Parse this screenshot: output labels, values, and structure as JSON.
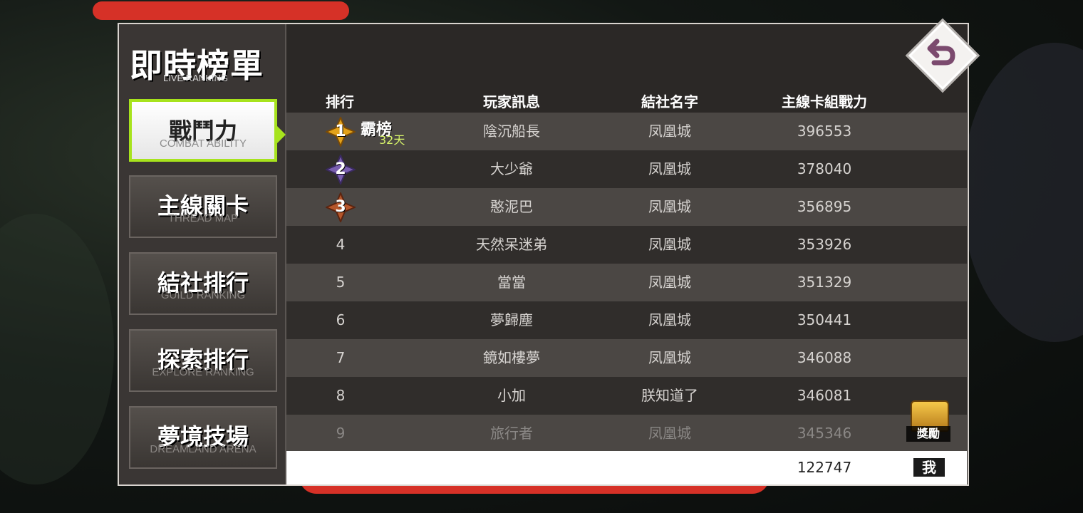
{
  "page": {
    "title_zh": "即時榜單",
    "title_en": "LIVE RANKING"
  },
  "tabs": [
    {
      "zh": "戰鬥力",
      "en": "COMBAT ABILITY",
      "active": true
    },
    {
      "zh": "主線關卡",
      "en": "THREAD MAP",
      "active": false
    },
    {
      "zh": "結社排行",
      "en": "GUILD RANKING",
      "active": false
    },
    {
      "zh": "探索排行",
      "en": "EXPLORE RANKING",
      "active": false
    },
    {
      "zh": "夢境技場",
      "en": "DREAMLAND ARENA",
      "active": false
    }
  ],
  "table": {
    "headers": {
      "rank": "排行",
      "player": "玩家訊息",
      "guild": "結社名字",
      "power": "主線卡組戰力"
    },
    "champion": {
      "label": "霸榜",
      "days": "32天"
    },
    "rows": [
      {
        "rank": "1",
        "player": "陰沉船長",
        "guild": "凤凰城",
        "power": "396553"
      },
      {
        "rank": "2",
        "player": "大少爺",
        "guild": "凤凰城",
        "power": "378040"
      },
      {
        "rank": "3",
        "player": "憨泥巴",
        "guild": "凤凰城",
        "power": "356895"
      },
      {
        "rank": "4",
        "player": "天然呆迷弟",
        "guild": "凤凰城",
        "power": "353926"
      },
      {
        "rank": "5",
        "player": "當當",
        "guild": "凤凰城",
        "power": "351329"
      },
      {
        "rank": "6",
        "player": "夢歸塵",
        "guild": "凤凰城",
        "power": "350441"
      },
      {
        "rank": "7",
        "player": "鏡如樓夢",
        "guild": "凤凰城",
        "power": "346088"
      },
      {
        "rank": "8",
        "player": "小加",
        "guild": "朕知道了",
        "power": "346081"
      },
      {
        "rank": "9",
        "player": "旅行者",
        "guild": "凤凰城",
        "power": "345346"
      }
    ]
  },
  "self_row": {
    "power": "122747",
    "me_label": "我"
  },
  "reward": {
    "label": "獎勵"
  },
  "icons": {
    "back": "back-arrow-icon",
    "reward": "treasure-chest-icon"
  },
  "colors": {
    "accent": "#a7e31d",
    "gold": "#e3a21a",
    "silver": "#7a5fb0",
    "bronze": "#b5562a",
    "redaction": "#d63127"
  }
}
